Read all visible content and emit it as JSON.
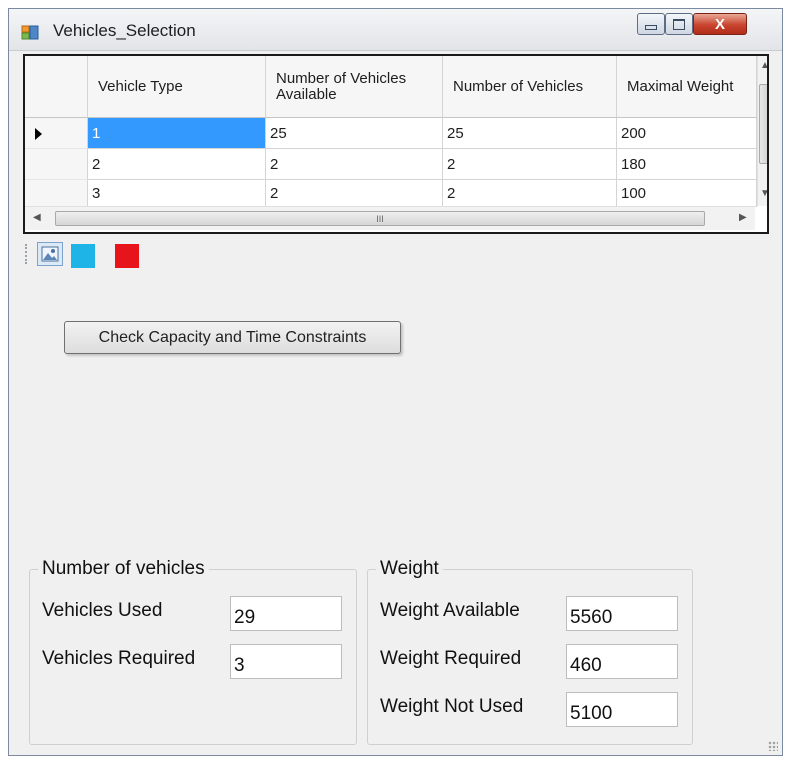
{
  "window": {
    "title": "Vehicles_Selection",
    "close_glyph": "X"
  },
  "grid": {
    "columns": [
      "Vehicle Type",
      "Number of Vehicles Available",
      "Number of Vehicles",
      "Maximal Weight"
    ],
    "rows": [
      [
        "1",
        "25",
        "25",
        "200"
      ],
      [
        "2",
        "2",
        "2",
        "180"
      ],
      [
        "3",
        "2",
        "2",
        "100"
      ]
    ],
    "selected_row": 0,
    "hscroll_grip": "III"
  },
  "toolbar": {
    "color1": "#1fb4e8",
    "color2": "#e8141c"
  },
  "check_button_label": "Check Capacity and Time Constraints",
  "number_of_vehicles": {
    "title": "Number of vehicles",
    "vehicles_used_label": "Vehicles Used",
    "vehicles_used_value": "29",
    "vehicles_required_label": "Vehicles Required",
    "vehicles_required_value": "3"
  },
  "weight": {
    "title": "Weight",
    "available_label": "Weight Available",
    "available_value": "5560",
    "required_label": "Weight Required",
    "required_value": "460",
    "not_used_label": "Weight Not Used",
    "not_used_value": "5100"
  }
}
